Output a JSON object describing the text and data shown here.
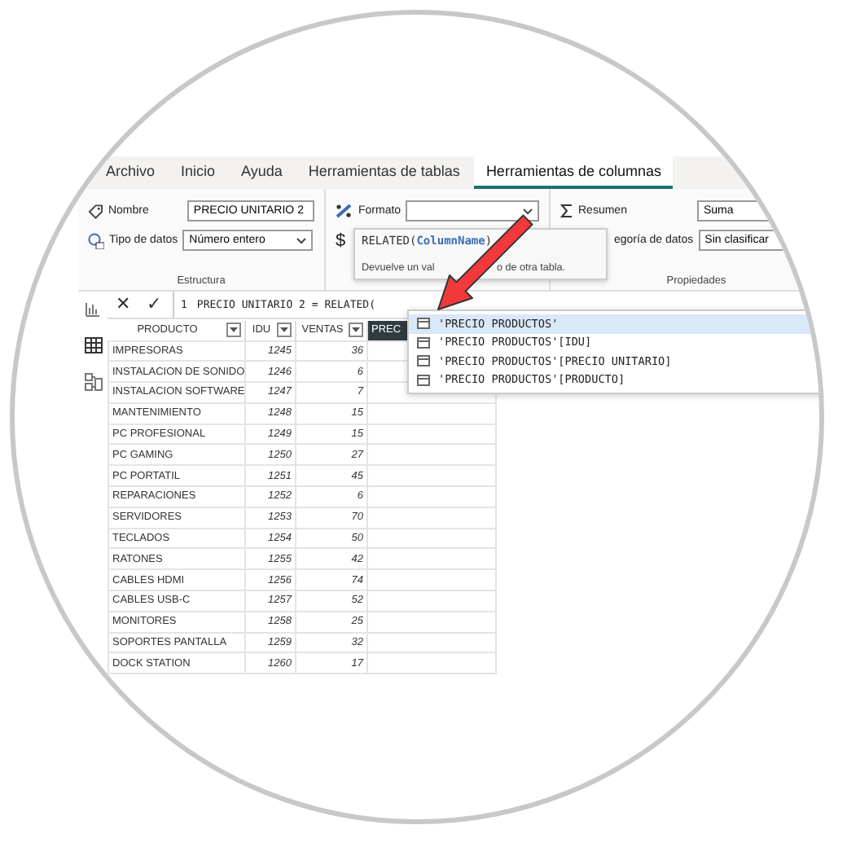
{
  "tabs": [
    {
      "label": "Archivo",
      "selected": false
    },
    {
      "label": "Inicio",
      "selected": false
    },
    {
      "label": "Ayuda",
      "selected": false
    },
    {
      "label": "Herramientas de tablas",
      "selected": false
    },
    {
      "label": "Herramientas de columnas",
      "selected": true
    }
  ],
  "ribbon": {
    "structure": {
      "name_label": "Nombre",
      "name_value": "PRECIO UNITARIO 2",
      "type_label": "Tipo de datos",
      "type_value": "Número entero",
      "group_label": "Estructura"
    },
    "format": {
      "format_label": "Formato",
      "currency_symbol": "$"
    },
    "properties": {
      "summary_label": "Resumen",
      "summary_value": "Suma",
      "category_label": "egoría de datos",
      "category_value": "Sin clasificar",
      "group_label": "Propiedades"
    }
  },
  "tooltip": {
    "signature_function": "RELATED(",
    "signature_param": "ColumnName",
    "signature_close": ")",
    "description_start": "Devuelve un val",
    "description_end": "o de otra tabla."
  },
  "formula": {
    "cancel": "✕",
    "confirm": "✓",
    "line_number": "1",
    "text": "PRECIO UNITARIO 2 = RELATED("
  },
  "suggestions": [
    {
      "label": "'PRECIO PRODUCTOS'",
      "selected": true
    },
    {
      "label": "'PRECIO PRODUCTOS'[IDU]",
      "selected": false
    },
    {
      "label": "'PRECIO PRODUCTOS'[PRECIO UNITARIO]",
      "selected": false
    },
    {
      "label": "'PRECIO PRODUCTOS'[PRODUCTO]",
      "selected": false
    }
  ],
  "table": {
    "columns": [
      {
        "label": "PRODUCTO",
        "filter": true,
        "selected": false
      },
      {
        "label": "IDU",
        "filter": true,
        "selected": false
      },
      {
        "label": "VENTAS",
        "filter": true,
        "selected": false
      },
      {
        "label": "PREC",
        "filter": false,
        "selected": true
      }
    ],
    "rows": [
      [
        "IMPRESORAS",
        "1245",
        "36"
      ],
      [
        "INSTALACION DE SONIDO",
        "1246",
        "6"
      ],
      [
        "INSTALACION SOFTWARE",
        "1247",
        "7"
      ],
      [
        "MANTENIMIENTO",
        "1248",
        "15"
      ],
      [
        "PC PROFESIONAL",
        "1249",
        "15"
      ],
      [
        "PC GAMING",
        "1250",
        "27"
      ],
      [
        "PC PORTATIL",
        "1251",
        "45"
      ],
      [
        "REPARACIONES",
        "1252",
        "6"
      ],
      [
        "SERVIDORES",
        "1253",
        "70"
      ],
      [
        "TECLADOS",
        "1254",
        "50"
      ],
      [
        "RATONES",
        "1255",
        "42"
      ],
      [
        "CABLES HDMI",
        "1256",
        "74"
      ],
      [
        "CABLES USB-C",
        "1257",
        "52"
      ],
      [
        "MONITORES",
        "1258",
        "25"
      ],
      [
        "SOPORTES PANTALLA",
        "1259",
        "32"
      ],
      [
        "DOCK STATION",
        "1260",
        "17"
      ]
    ]
  }
}
